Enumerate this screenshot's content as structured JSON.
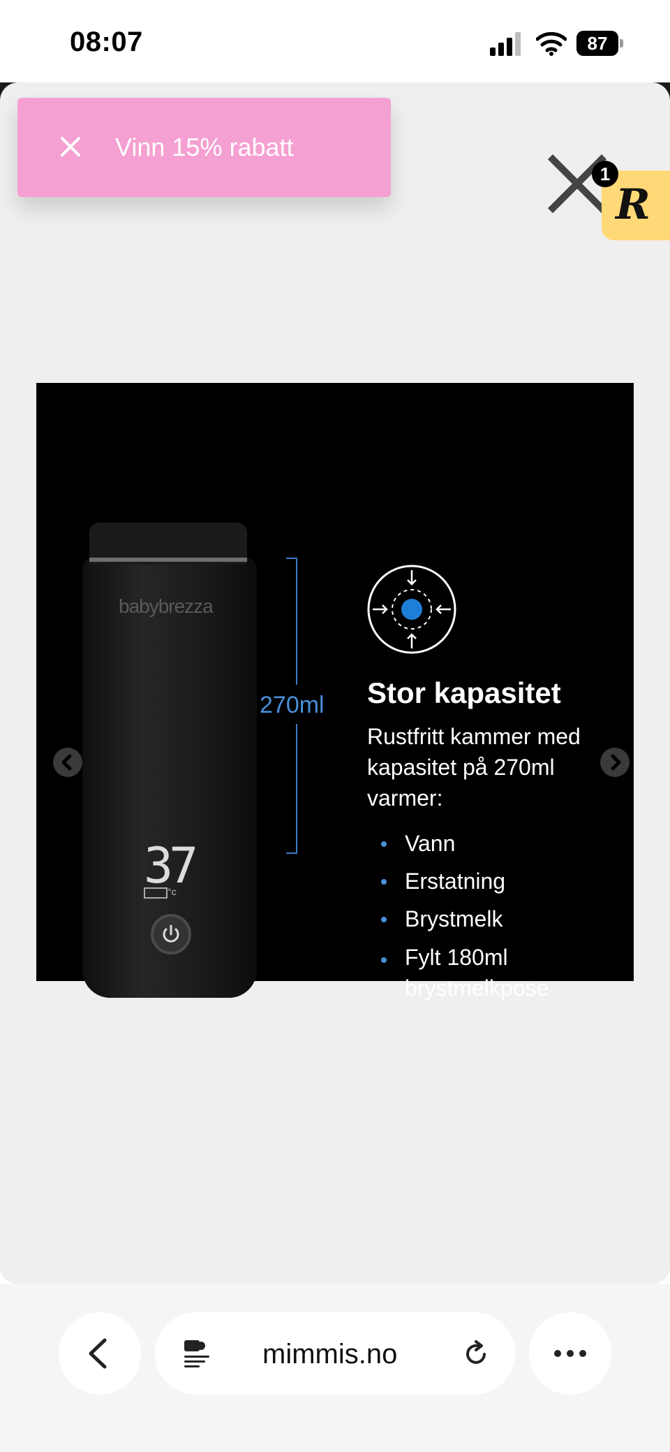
{
  "status_bar": {
    "time": "08:07",
    "battery": "87"
  },
  "promo": {
    "text": "Vinn 15% rabatt"
  },
  "reward_widget": {
    "letter": "R",
    "badge_count": "1"
  },
  "slide": {
    "product_brand": "babybrezza",
    "display_temp": "37",
    "display_unit": "°c",
    "capacity_label": "270ml",
    "title": "Stor kapasitet",
    "description": "Rustfritt kammer med kapasitet på 270ml varmer:",
    "features": [
      "Vann",
      "Erstatning",
      "Brystmelk",
      "Fylt 180ml brystmelkpose"
    ]
  },
  "browser": {
    "url": "mimmis.no"
  },
  "colors": {
    "promo_bg": "#f5a0d2",
    "reward_bg": "#ffd977",
    "accent_blue": "#1e7fd6"
  }
}
